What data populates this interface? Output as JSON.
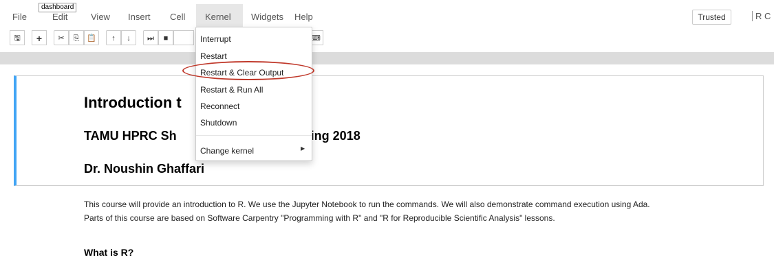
{
  "menubar": {
    "items": [
      "File",
      "Edit",
      "View",
      "Insert",
      "Cell",
      "Kernel",
      "Widgets",
      "Help"
    ],
    "tooltip": "dashboard",
    "trusted": "Trusted",
    "kernel_indicator": "R  C"
  },
  "toolbar": {
    "icons": [
      "save-icon",
      "add-icon",
      "cut-icon",
      "copy-icon",
      "paste-icon",
      "up-arrow-icon",
      "down-arrow-icon",
      "run-icon",
      "stop-icon"
    ],
    "glyphs": {
      "save": "🖫",
      "add": "+",
      "cut": "✂",
      "copy": "⎘",
      "paste": "📋",
      "up": "↑",
      "down": "↓",
      "run": "⏭",
      "stop": "■",
      "keyboard": "⌨"
    }
  },
  "kernel_menu": {
    "items": [
      "Interrupt",
      "Restart",
      "Restart & Clear Output",
      "Restart & Run All",
      "Reconnect",
      "Shutdown"
    ],
    "submenu": "Change kernel",
    "submenu_arrow": "▶",
    "highlighted": "Restart & Clear Output",
    "highlight_color": "#c0392b"
  },
  "notebook": {
    "title": "Introduction t",
    "subtitle_left": "TAMU HPRC Sh",
    "subtitle_right": "ring 2018",
    "author": "Dr. Noushin Ghaffari",
    "paragraph_line1": "This course will provide an introduction to R. We use the Jupyter Notebook to run the commands. We will also demonstrate command execution using Ada.",
    "paragraph_line2": "Parts of this course are based on Software Carpentry \"Programming with R\" and \"R for Reproducible Scientific Analysis\" lessons.",
    "section_heading": "What is R?",
    "cell_border_color": "#42a5f5"
  }
}
